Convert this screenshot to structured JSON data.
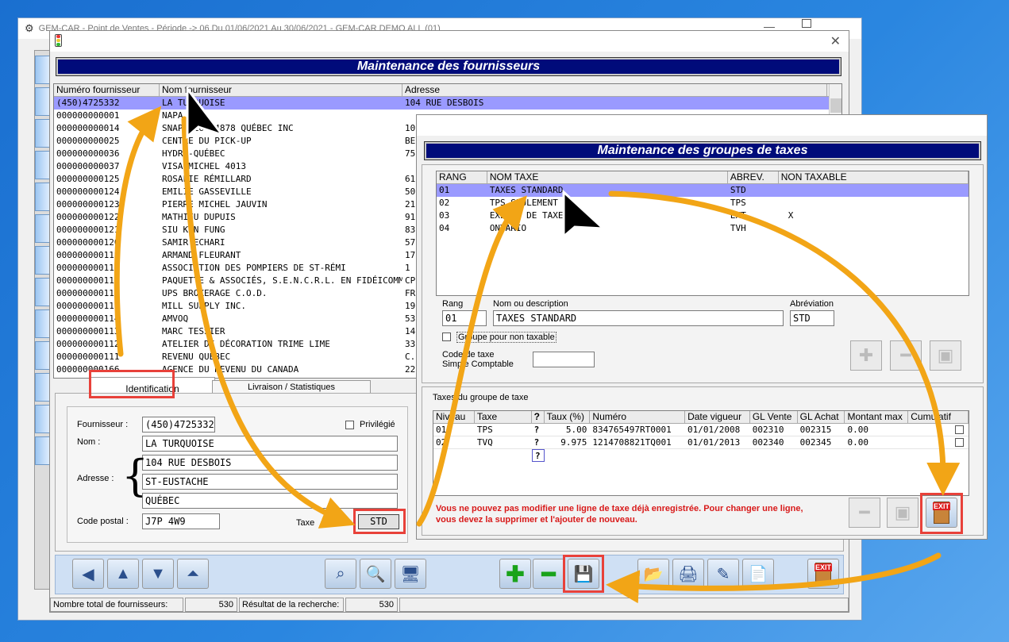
{
  "app": {
    "title": "GEM-CAR - Point de Ventes - Période -> 06 Du 01/06/2021 Au 30/06/2021 - GEM-CAR DEMO ALL (01)"
  },
  "supplier_window": {
    "title": "Maintenance des fournisseurs",
    "columns": [
      "Numéro fournisseur",
      "Nom fournisseur",
      "Adresse"
    ],
    "rows": [
      [
        "(450)4725332",
        "LA TURQUOISE",
        "104 RUE DESBOIS"
      ],
      [
        "000000000001",
        "NAPA",
        ""
      ],
      [
        "000000000014",
        "SNAP 9164-4878 QUÉBEC INC",
        "10"
      ],
      [
        "000000000025",
        "CENTRE DU PICK-UP",
        "BE"
      ],
      [
        "000000000036",
        "HYDRO-QUÉBEC",
        "75"
      ],
      [
        "000000000037",
        "VISA MICHEL 4013",
        ""
      ],
      [
        "000000000125",
        "ROSALIE RÉMILLARD",
        "61"
      ],
      [
        "000000000124",
        "EMILIE GASSEVILLE",
        "50"
      ],
      [
        "000000000123",
        "PIERRE MICHEL JAUVIN",
        "21"
      ],
      [
        "000000000122",
        "MATHIEU DUPUIS",
        "91"
      ],
      [
        "000000000121",
        "SIU KIN FUNG",
        "83"
      ],
      [
        "000000000120",
        "SAMIR ECHARI",
        "57"
      ],
      [
        "000000000119",
        "ARMAND FLEURANT",
        "17"
      ],
      [
        "000000000118",
        "ASSOCIATION DES POMPIERS DE ST-RÉMI",
        "1"
      ],
      [
        "000000000117",
        "PAQUETTE & ASSOCIÉS, S.E.N.C.R.L. EN FIDÉICOMMIS",
        "CP"
      ],
      [
        "000000000116",
        "UPS BROKERAGE C.O.D.",
        "FR"
      ],
      [
        "000000000115",
        "MILL SUPPLY INC.",
        "19"
      ],
      [
        "000000000114",
        "AMVOQ",
        "53"
      ],
      [
        "000000000113",
        "MARC TESSIER",
        "14"
      ],
      [
        "000000000112",
        "ATELIER DE DÉCORATION TRIME LIME",
        "33"
      ],
      [
        "000000000111",
        "REVENU QUÉBEC",
        "C."
      ],
      [
        "000000000166",
        "AGENCE DU REVENU DU CANADA",
        "22"
      ]
    ],
    "tabs": [
      "Identification",
      "Livraison / Statistiques"
    ],
    "form": {
      "fournisseur_label": "Fournisseur :",
      "fournisseur": "(450)4725332",
      "privilegie_label": "Privilégié",
      "nom_label": "Nom :",
      "nom": "LA TURQUOISE",
      "adresse_label": "Adresse :",
      "adresse1": "104 RUE DESBOIS",
      "adresse2": "ST-EUSTACHE",
      "adresse3": "QUÉBEC",
      "code_postal_label": "Code postal :",
      "code_postal": "J7P 4W9",
      "taxe_label": "Taxe",
      "taxe": "STD"
    },
    "status": {
      "total_label": "Nombre total de fournisseurs:",
      "total": "530",
      "result_label": "Résultat de la recherche:",
      "result": "530"
    }
  },
  "tax_window": {
    "title": "Maintenance des groupes de taxes",
    "columns": [
      "RANG",
      "NOM TAXE",
      "ABREV.",
      "NON TAXABLE"
    ],
    "rows": [
      [
        "01",
        "TAXES STANDARD",
        "STD",
        ""
      ],
      [
        "02",
        "TPS SEULEMENT",
        "TPS",
        ""
      ],
      [
        "03",
        "EXEMPT DE TAXE",
        "EXT",
        "X"
      ],
      [
        "04",
        "ONTARIO",
        "TVH",
        ""
      ]
    ],
    "form": {
      "rang_label": "Rang",
      "rang": "01",
      "nom_label": "Nom ou description",
      "nom": "TAXES STANDARD",
      "abrev_label": "Abréviation",
      "abrev": "STD",
      "non_taxable_label": "Groupe pour non taxable",
      "code_label_1": "Code de taxe",
      "code_label_2": "Simple Comptable"
    },
    "section_label": "Taxes du groupe de taxe",
    "detail_columns": [
      "Niveau",
      "Taxe",
      "?",
      "Taux (%)",
      "Numéro",
      "Date vigueur",
      "GL Vente",
      "GL Achat",
      "Montant max",
      "Cumulatif"
    ],
    "detail_rows": [
      [
        "01",
        "TPS",
        "?",
        "5.00",
        "834765497RT0001",
        "01/01/2008",
        "002310",
        "002315",
        "0.00"
      ],
      [
        "02",
        "TVQ",
        "?",
        "9.975",
        "1214708821TQ001",
        "01/01/2013",
        "002340",
        "002345",
        "0.00"
      ]
    ],
    "warning_1": "Vous ne pouvez pas modifier une ligne de taxe déjà enregistrée. Pour changer une ligne,",
    "warning_2": "vous devez la supprimer et l'ajouter de nouveau.",
    "exit_label": "EXIT"
  },
  "colors": {
    "accent": "#e8413a",
    "title_bar": "#000b7a",
    "selection": "#9a9aff",
    "arrow": "#f2a516"
  }
}
